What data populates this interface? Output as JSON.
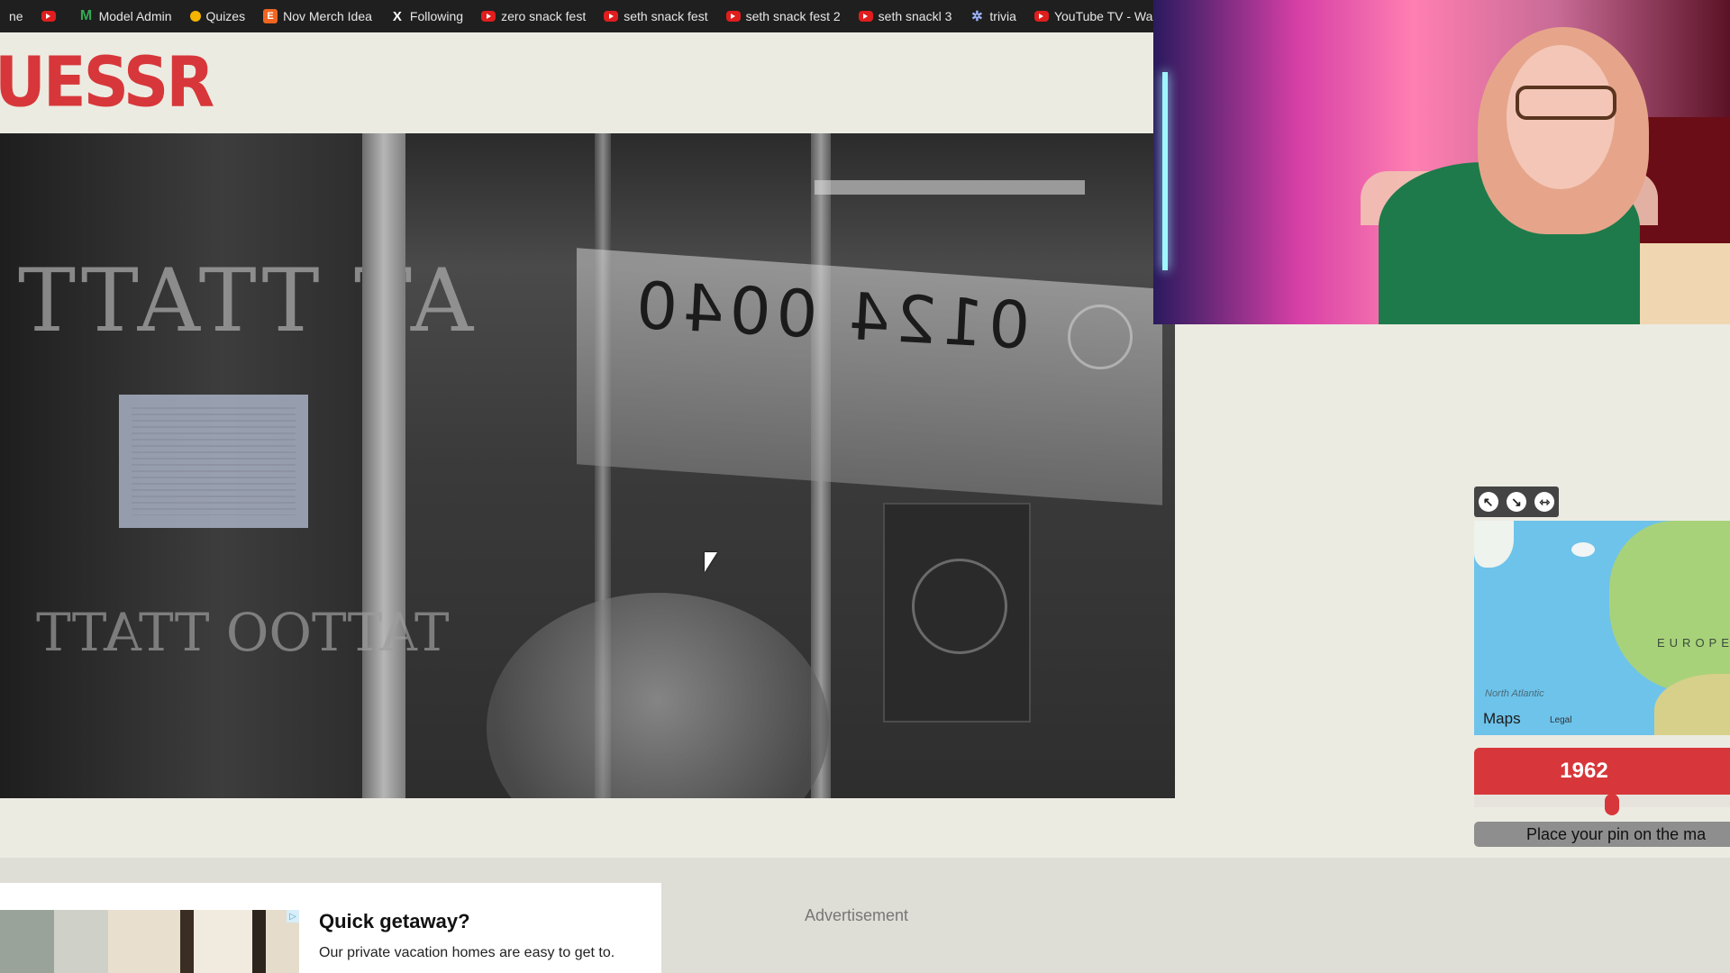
{
  "bookmarks": [
    {
      "label": "ne",
      "icon": "none"
    },
    {
      "label": "",
      "icon": "youtube-icon"
    },
    {
      "label": "Model Admin",
      "icon": "gmail-icon"
    },
    {
      "label": "Quizes",
      "icon": "lightbulb-icon"
    },
    {
      "label": "Nov Merch Idea",
      "icon": "etsy-icon"
    },
    {
      "label": "Following",
      "icon": "x-icon"
    },
    {
      "label": "zero snack fest",
      "icon": "youtube-icon"
    },
    {
      "label": "seth snack fest",
      "icon": "youtube-icon"
    },
    {
      "label": "seth snack fest 2",
      "icon": "youtube-icon"
    },
    {
      "label": "seth snackl 3",
      "icon": "youtube-icon"
    },
    {
      "label": "trivia",
      "icon": "star-icon"
    },
    {
      "label": "YouTube TV - Wa",
      "icon": "youtube-icon"
    }
  ],
  "header": {
    "logo_text": "UESSR"
  },
  "photo": {
    "sign_text": "0124 0040",
    "tattoo_top": "TTATT TA",
    "tattoo_bottom": "TATTOO TTATT"
  },
  "map": {
    "tools": [
      "↖",
      "↘",
      "⇿"
    ],
    "region_label": "EUROPE",
    "ocean_label": "North Atlantic",
    "maps_logo": "Maps",
    "legal": "Legal"
  },
  "game": {
    "year": "1962",
    "year_fraction": 0.54,
    "place_pin_label": "Place your pin on the ma"
  },
  "ad": {
    "title": "Quick getaway?",
    "subtitle": "Our private vacation homes are easy to get to.",
    "advertisement_label": "Advertisement"
  },
  "colors": {
    "accent": "#d7373a",
    "page_bg": "#ecebe2"
  }
}
